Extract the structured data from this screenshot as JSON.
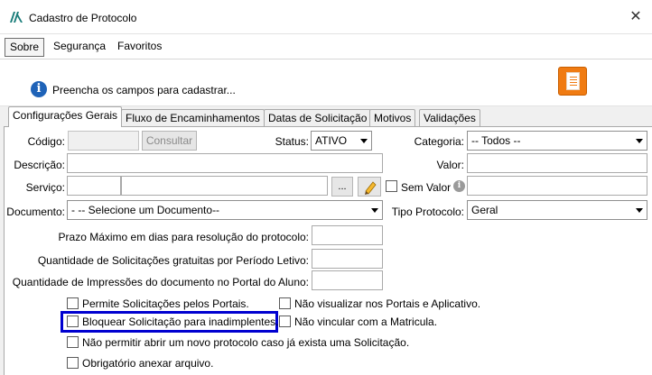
{
  "window": {
    "title": "Cadastro de Protocolo",
    "close_glyph": "✕"
  },
  "menu": {
    "items": [
      "Sobre",
      "Segurança",
      "Favoritos"
    ]
  },
  "info": {
    "icon_glyph": "i",
    "text": "Preencha os campos para cadastrar..."
  },
  "tabs": [
    "Configurações Gerais",
    "Fluxo de Encaminhamentos",
    "Datas de Solicitação",
    "Motivos",
    "Validações"
  ],
  "form": {
    "codigo_label": "Código:",
    "codigo_value": "",
    "consultar_label": "Consultar",
    "status_label": "Status:",
    "status_value": "ATIVO",
    "categoria_label": "Categoria:",
    "categoria_value": "-- Todos --",
    "descricao_label": "Descrição:",
    "descricao_value": "",
    "valor_label": "Valor:",
    "valor_value": "",
    "servico_label": "Serviço:",
    "servico_code": "",
    "servico_name": "",
    "ellipsis_label": "...",
    "sem_valor_label": "Sem Valor",
    "sem_valor_checked": false,
    "sem_valor_value": "",
    "documento_label": "Documento:",
    "documento_value": "- -- Selecione um Documento--",
    "tipo_protocolo_label": "Tipo Protocolo:",
    "tipo_protocolo_value": "Geral",
    "prazo_label": "Prazo Máximo em dias para resolução do protocolo:",
    "prazo_value": "",
    "qtd_gratuitas_label": "Quantidade de Solicitações gratuitas por Período Letivo:",
    "qtd_gratuitas_value": "",
    "qtd_impressoes_label": "Quantidade de Impressões do documento no Portal do Aluno:",
    "qtd_impressoes_value": ""
  },
  "checkboxes": {
    "permite_portais": {
      "label": "Permite Solicitações pelos Portais.",
      "checked": false
    },
    "nao_visualizar": {
      "label": "Não visualizar nos Portais e Aplicativo.",
      "checked": false
    },
    "bloquear_inadimplentes": {
      "label": "Bloquear Solicitação para inadimplentes.",
      "checked": false
    },
    "nao_vincular": {
      "label": "Não vincular com a Matricula.",
      "checked": false
    },
    "nao_permitir_novo": {
      "label": "Não permitir abrir um novo protocolo caso já exista uma Solicitação.",
      "checked": false
    },
    "obrigatorio_anexar": {
      "label": "Obrigatório anexar arquivo.",
      "checked": false
    }
  },
  "colors": {
    "highlight": "#0000d0",
    "info_icon": "#1f63b8",
    "doc_button": "#f07b12"
  }
}
